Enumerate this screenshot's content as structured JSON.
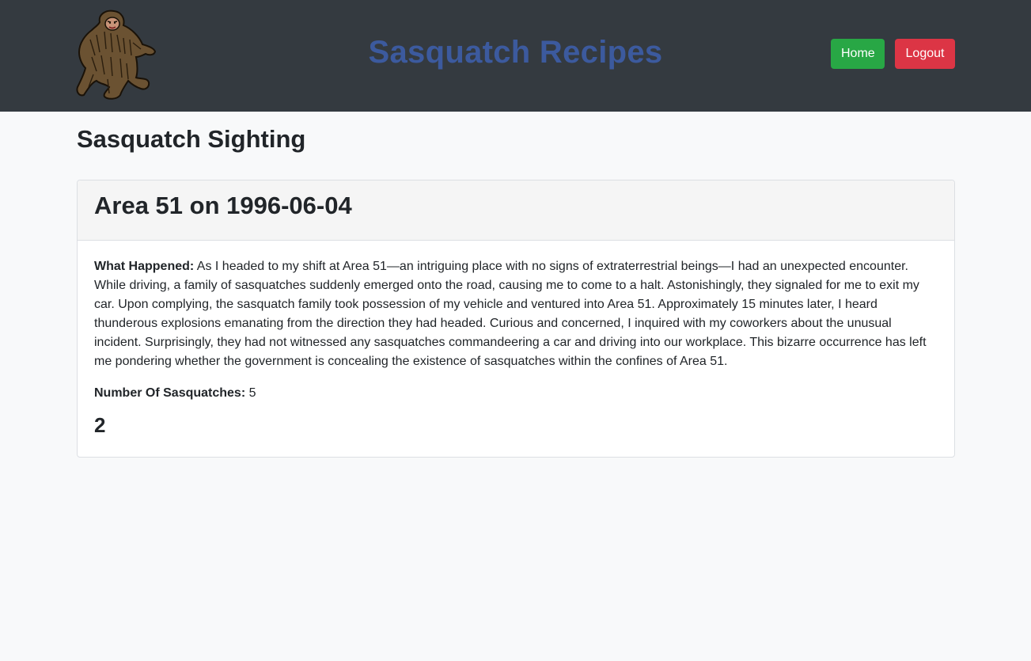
{
  "header": {
    "brand": "Sasquatch Recipes",
    "logo_icon": "sasquatch-logo",
    "home_label": "Home",
    "logout_label": "Logout"
  },
  "page": {
    "title": "Sasquatch Sighting"
  },
  "sighting": {
    "heading": "Area 51 on 1996-06-04",
    "what_happened_label": "What Happened:",
    "what_happened_text": "As I headed to my shift at Area 51—an intriguing place with no signs of extraterrestrial beings—I had an unexpected encounter. While driving, a family of sasquatches suddenly emerged onto the road, causing me to come to a halt. Astonishingly, they signaled for me to exit my car. Upon complying, the sasquatch family took possession of my vehicle and ventured into Area 51. Approximately 15 minutes later, I heard thunderous explosions emanating from the direction they had headed. Curious and concerned, I inquired with my coworkers about the unusual incident. Surprisingly, they had not witnessed any sasquatches commandeering a car and driving into our workplace. This bizarre occurrence has left me pondering whether the government is concealing the existence of sasquatches within the confines of Area 51.",
    "count_label": "Number Of Sasquatches:",
    "count_value": "5",
    "extra_number": "2"
  },
  "colors": {
    "navbar": "#343a40",
    "brand": "#3c5a9e",
    "home_button": "#28a745",
    "logout_button": "#dc3545"
  }
}
